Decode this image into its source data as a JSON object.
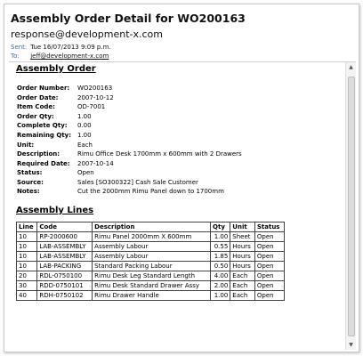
{
  "header": {
    "subject": "Assembly Order Detail for WO200163",
    "sender": "response@development-x.com",
    "sent_label": "Sent:",
    "sent_value": "Tue 16/07/2013 9:09 p.m.",
    "to_label": "To:",
    "to_value": "jeff@development-x.com"
  },
  "order": {
    "title": "Assembly Order",
    "fields": [
      {
        "label": "Order Number:",
        "value": "WO200163"
      },
      {
        "label": "Order Date:",
        "value": "2007-10-12"
      },
      {
        "label": "Item Code:",
        "value": "OD-7001"
      },
      {
        "label": "Order Qty:",
        "value": "1.00"
      },
      {
        "label": "Complete Qty:",
        "value": "0.00"
      },
      {
        "label": "Remaining Qty:",
        "value": "1.00"
      },
      {
        "label": "Unit:",
        "value": "Each"
      },
      {
        "label": "Description:",
        "value": "Rimu Office Desk 1700mm x 600mm with 2 Drawers"
      },
      {
        "label": "Required Date:",
        "value": "2007-10-14"
      },
      {
        "label": "Status:",
        "value": "Open"
      },
      {
        "label": "Source:",
        "value": "Sales [SO300322] Cash Sale Customer"
      },
      {
        "label": "Notes:",
        "value": "Cut the 2000mm Rimu Panel down to 1700mm"
      }
    ]
  },
  "lines": {
    "title": "Assembly Lines",
    "headers": [
      "Line",
      "Code",
      "Description",
      "Qty",
      "Unit",
      "Status"
    ],
    "rows": [
      [
        "10",
        "RP-2000600",
        "Rimu Panel 2000mm X 600mm",
        "1.00",
        "Sheet",
        "Open"
      ],
      [
        "10",
        "LAB-ASSEMBLY",
        "Assembly Labour",
        "0.55",
        "Hours",
        "Open"
      ],
      [
        "10",
        "LAB-ASSEMBLY",
        "Assembly Labour",
        "1.85",
        "Hours",
        "Open"
      ],
      [
        "10",
        "LAB-PACKING",
        "Standard Packing Labour",
        "0.50",
        "Hours",
        "Open"
      ],
      [
        "20",
        "RDL-0750100",
        "Rimu Desk Leg Standard Length",
        "4.00",
        "Each",
        "Open"
      ],
      [
        "30",
        "RDD-0750101",
        "Rimu Desk Standard Drawer Assy",
        "2.00",
        "Each",
        "Open"
      ],
      [
        "40",
        "RDH-0750102",
        "Rimu Drawer Handle",
        "1.00",
        "Each",
        "Open"
      ]
    ]
  },
  "icons": {
    "scroll_up": "scroll-up-arrow-icon",
    "scroll_down": "scroll-down-arrow-icon"
  }
}
